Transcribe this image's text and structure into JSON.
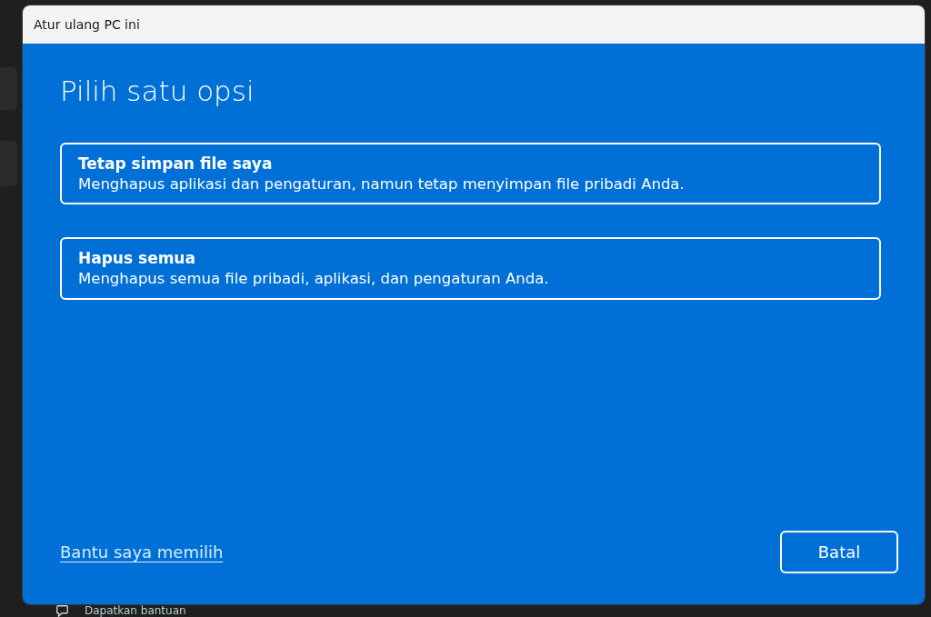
{
  "window": {
    "title": "Atur ulang PC ini"
  },
  "heading": "Pilih satu opsi",
  "options": [
    {
      "title": "Tetap simpan file saya",
      "description": "Menghapus aplikasi dan pengaturan, namun tetap menyimpan file pribadi Anda."
    },
    {
      "title": "Hapus semua",
      "description": "Menghapus semua file pribadi, aplikasi, dan pengaturan Anda."
    }
  ],
  "help_link": "Bantu saya memilih",
  "buttons": [
    "Batal"
  ],
  "background": {
    "help_item": "Dapatkan bantuan"
  }
}
